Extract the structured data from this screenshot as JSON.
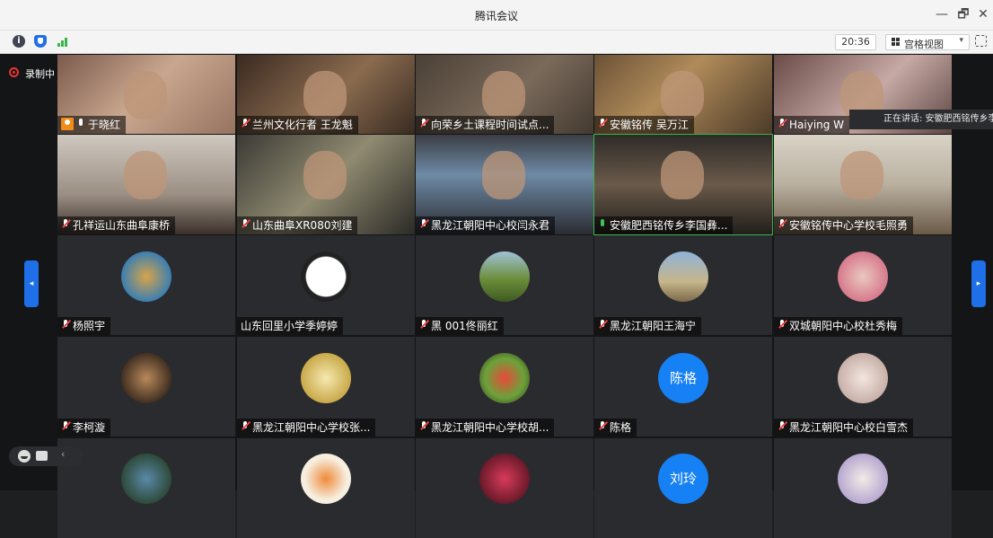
{
  "window": {
    "title": "腾讯会议",
    "minimize_label": "—",
    "restore_label": "🗗",
    "close_label": "✕"
  },
  "toolbar": {
    "time": "20:36",
    "view_label": "宫格视图",
    "view_chevron": "▾"
  },
  "recording": {
    "label": "录制中"
  },
  "speaker_banner": "正在讲话: 安徽肥西铭传乡李",
  "participants": [
    {
      "name": "于晓红",
      "kind": "video",
      "host": true,
      "mic": "on",
      "bg": "linear-gradient(135deg,#7b5a4d,#c9a78f 45%,#8e6b58)"
    },
    {
      "name": "兰州文化行者 王龙魁",
      "kind": "video",
      "mic": "muted",
      "bg": "linear-gradient(135deg,#3a2a21,#8a6b4f 50%,#2b2019)"
    },
    {
      "name": "向荣乡土课程时间试点...",
      "kind": "video",
      "mic": "muted",
      "bg": "linear-gradient(135deg,#4a4036,#7a6a5a 50%,#3a3129)"
    },
    {
      "name": "安徽铭传 吴万江",
      "kind": "video",
      "mic": "muted",
      "bg": "linear-gradient(135deg,#6b5236,#b08b5a 40%,#3e2f21)"
    },
    {
      "name": "Haiying W",
      "kind": "video",
      "mic": "muted",
      "bg": "linear-gradient(135deg,#6a4b47,#c6a9a4 50%,#4a3532)"
    },
    {
      "name": "孔祥运山东曲阜康桥",
      "kind": "video",
      "mic": "muted",
      "bg": "linear-gradient(180deg,#cfc8bf,#9b8f83 60%,#3a302a)"
    },
    {
      "name": "山东曲阜XR080刘建",
      "kind": "video",
      "mic": "muted",
      "bg": "linear-gradient(135deg,#3b3a35,#8f8a70 50%,#2b2a26)"
    },
    {
      "name": "黑龙江朝阳中心校闫永君",
      "kind": "video",
      "mic": "muted",
      "bg": "linear-gradient(180deg,#3b3e44,#6e8aa6 40%,#2a2c31)"
    },
    {
      "name": "安徽肥西铭传乡李国彝...",
      "kind": "video",
      "mic": "speaking",
      "active": true,
      "bg": "linear-gradient(180deg,#2e2b28,#6a5a4a 50%,#211e1b)"
    },
    {
      "name": "安徽铭传中心学校毛照勇",
      "kind": "video",
      "mic": "muted",
      "bg": "linear-gradient(180deg,#d9d3c6,#b9b0a0 50%,#6b5a48)"
    },
    {
      "name": "杨照宇",
      "kind": "avatar",
      "mic": "muted",
      "bg": "radial-gradient(circle,#d8a34a,#3c7fb0 70%)"
    },
    {
      "name": "山东回里小学季婷婷",
      "kind": "avatar",
      "mic": "none",
      "bg": "radial-gradient(circle,#ffffff 55%,#222 58%)"
    },
    {
      "name": "黑 001佟丽红",
      "kind": "avatar",
      "mic": "muted",
      "bg": "linear-gradient(180deg,#9fc2d8,#6b8e3a 55%,#3e5a22)"
    },
    {
      "name": "黑龙江朝阳王海宁",
      "kind": "avatar",
      "mic": "muted",
      "bg": "linear-gradient(180deg,#8fb3d9,#c6b68a 60%,#7b6a4a)"
    },
    {
      "name": "双城朝阳中心校杜秀梅",
      "kind": "avatar",
      "mic": "muted",
      "bg": "radial-gradient(circle,#e9c8c0,#d77a8c 70%)"
    },
    {
      "name": "李柯漩",
      "kind": "avatar",
      "mic": "muted",
      "bg": "radial-gradient(circle,#b8895a,#3a2a1e 75%)"
    },
    {
      "name": "黑龙江朝阳中心学校张...",
      "kind": "avatar",
      "mic": "muted",
      "bg": "radial-gradient(circle,#f6e9b0,#c9a94a 70%)"
    },
    {
      "name": "黑龙江朝阳中心学校胡...",
      "kind": "avatar",
      "mic": "muted",
      "bg": "radial-gradient(circle,#e84a3a,#6aa33a 55%,#3a2a1a)"
    },
    {
      "name": "陈格",
      "kind": "text-avatar",
      "avatar_text": "陈格",
      "mic": "muted"
    },
    {
      "name": "黑龙江朝阳中心校白雪杰",
      "kind": "avatar",
      "mic": "muted",
      "bg": "radial-gradient(circle,#f2e6e0,#c8b0a8 70%)"
    },
    {
      "name": "",
      "kind": "avatar",
      "mic": "none",
      "bg": "radial-gradient(circle,#5a8aa8,#2e4a3a 70%)"
    },
    {
      "name": "",
      "kind": "avatar",
      "mic": "none",
      "bg": "radial-gradient(circle,#f08a3a,#f6efe0 60%)"
    },
    {
      "name": "",
      "kind": "avatar",
      "mic": "none",
      "bg": "radial-gradient(circle,#d93a5a,#6a1a2a 70%)"
    },
    {
      "name": "",
      "kind": "text-avatar",
      "avatar_text": "刘玲",
      "mic": "none"
    },
    {
      "name": "",
      "kind": "avatar",
      "mic": "none",
      "bg": "radial-gradient(circle,#f0ece6,#b8a8d0 70%)"
    }
  ],
  "nav": {
    "prev_label": "◂",
    "next_label": "▸"
  },
  "bottom": {
    "collapse_label": "‹"
  },
  "colors": {
    "accent": "#1f6fe8",
    "recording": "#ee3333",
    "active_speaker": "#38b649"
  }
}
